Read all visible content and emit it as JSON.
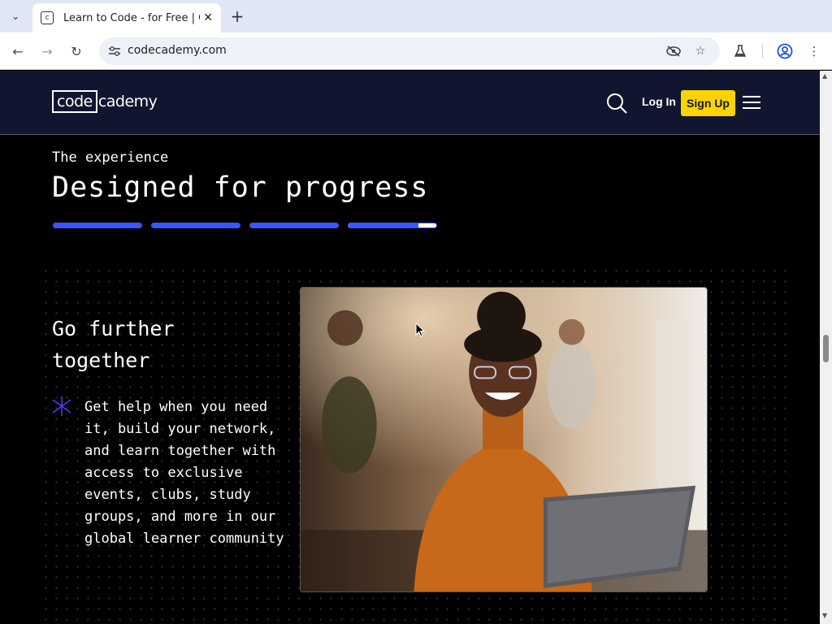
{
  "browser": {
    "tab_title": "Learn to Code - for Free | Codecademy",
    "url": "codecademy.com",
    "icons": [
      "tab-search-icon",
      "favicon-icon",
      "close-icon",
      "plus-icon",
      "back-icon",
      "forward-icon",
      "reload-icon",
      "site-info-icon",
      "eye-off-icon",
      "star-icon",
      "labs-icon",
      "profile-icon",
      "more-icon"
    ]
  },
  "header": {
    "logo_box": "code",
    "logo_rest": "cademy",
    "login_label": "Log In",
    "signup_label": "Sign Up",
    "colors": {
      "bg": "#10162f",
      "cta": "#ffd300"
    }
  },
  "hero": {
    "eyebrow": "The experience",
    "headline": "Designed for progress",
    "progress": [
      1,
      1,
      1,
      0.8
    ]
  },
  "feature": {
    "title": "Go further together",
    "body": "Get help when you need it, build your network, and learn together with access to exclusive events, clubs, study groups, and more in our global learner community",
    "accent": "#5533ff"
  }
}
